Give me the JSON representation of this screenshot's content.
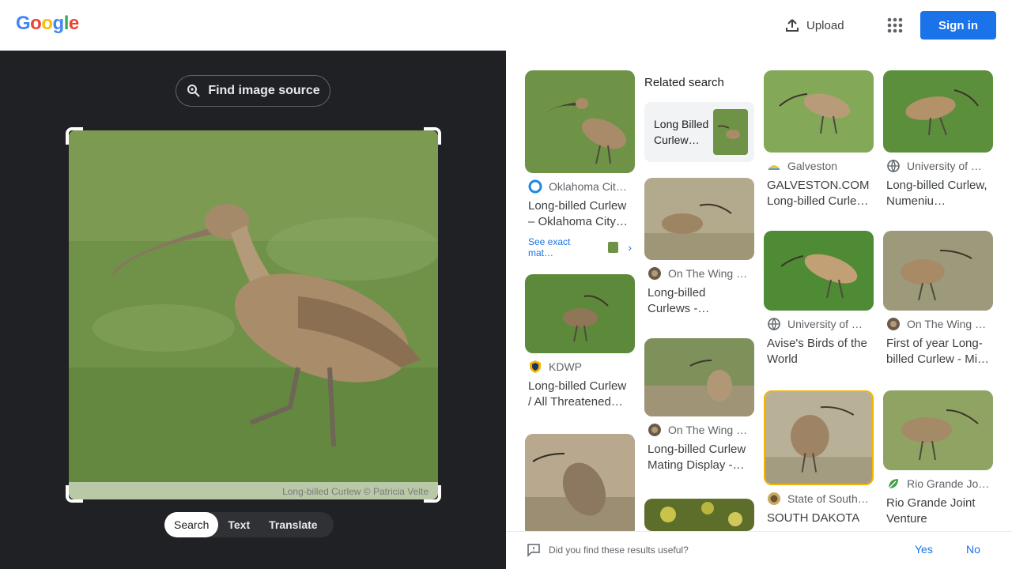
{
  "header": {
    "logo": "Google",
    "upload_label": "Upload",
    "signin_label": "Sign in"
  },
  "lens": {
    "find_source_label": "Find image source",
    "watermark": "Long-billed Curlew © Patricia Velte",
    "modes": [
      "Search",
      "Text",
      "Translate"
    ]
  },
  "related": {
    "heading": "Related search",
    "item_label": "Long Billed Curlew…"
  },
  "results": [
    {
      "source": "Oklahoma City…",
      "title": "Long-billed Curlew – Oklahoma City…",
      "see_exact": "See exact mat…"
    },
    {
      "source": "KDWP",
      "title": "Long-billed Curlew / All Threatened…"
    },
    {
      "source": "On The Wing P…",
      "title": "Long-billed Curlews -…"
    },
    {
      "source": "On The Wing P…",
      "title": "Long-billed Curlew Mating Display -…"
    },
    {
      "source": "Galveston",
      "title": "GALVESTON.COM: Long-billed Curle…"
    },
    {
      "source": "University of C…",
      "title": "Avise's Birds of the World"
    },
    {
      "source": "State of South …",
      "title": "SOUTH DAKOTA"
    },
    {
      "source": "University of C…",
      "title": "Long-billed Curlew, Numeniu…"
    },
    {
      "source": "On The Wing P…",
      "title": "First of year Long-billed Curlew - Mi…"
    },
    {
      "source": "Rio Grande Joi…",
      "title": "Rio Grande Joint Venture"
    }
  ],
  "feedback": {
    "question": "Did you find these results useful?",
    "yes": "Yes",
    "no": "No"
  },
  "colors": {
    "accent": "#1a73e8",
    "dark_pane": "#202124",
    "selected_outline": "#f4b400"
  }
}
